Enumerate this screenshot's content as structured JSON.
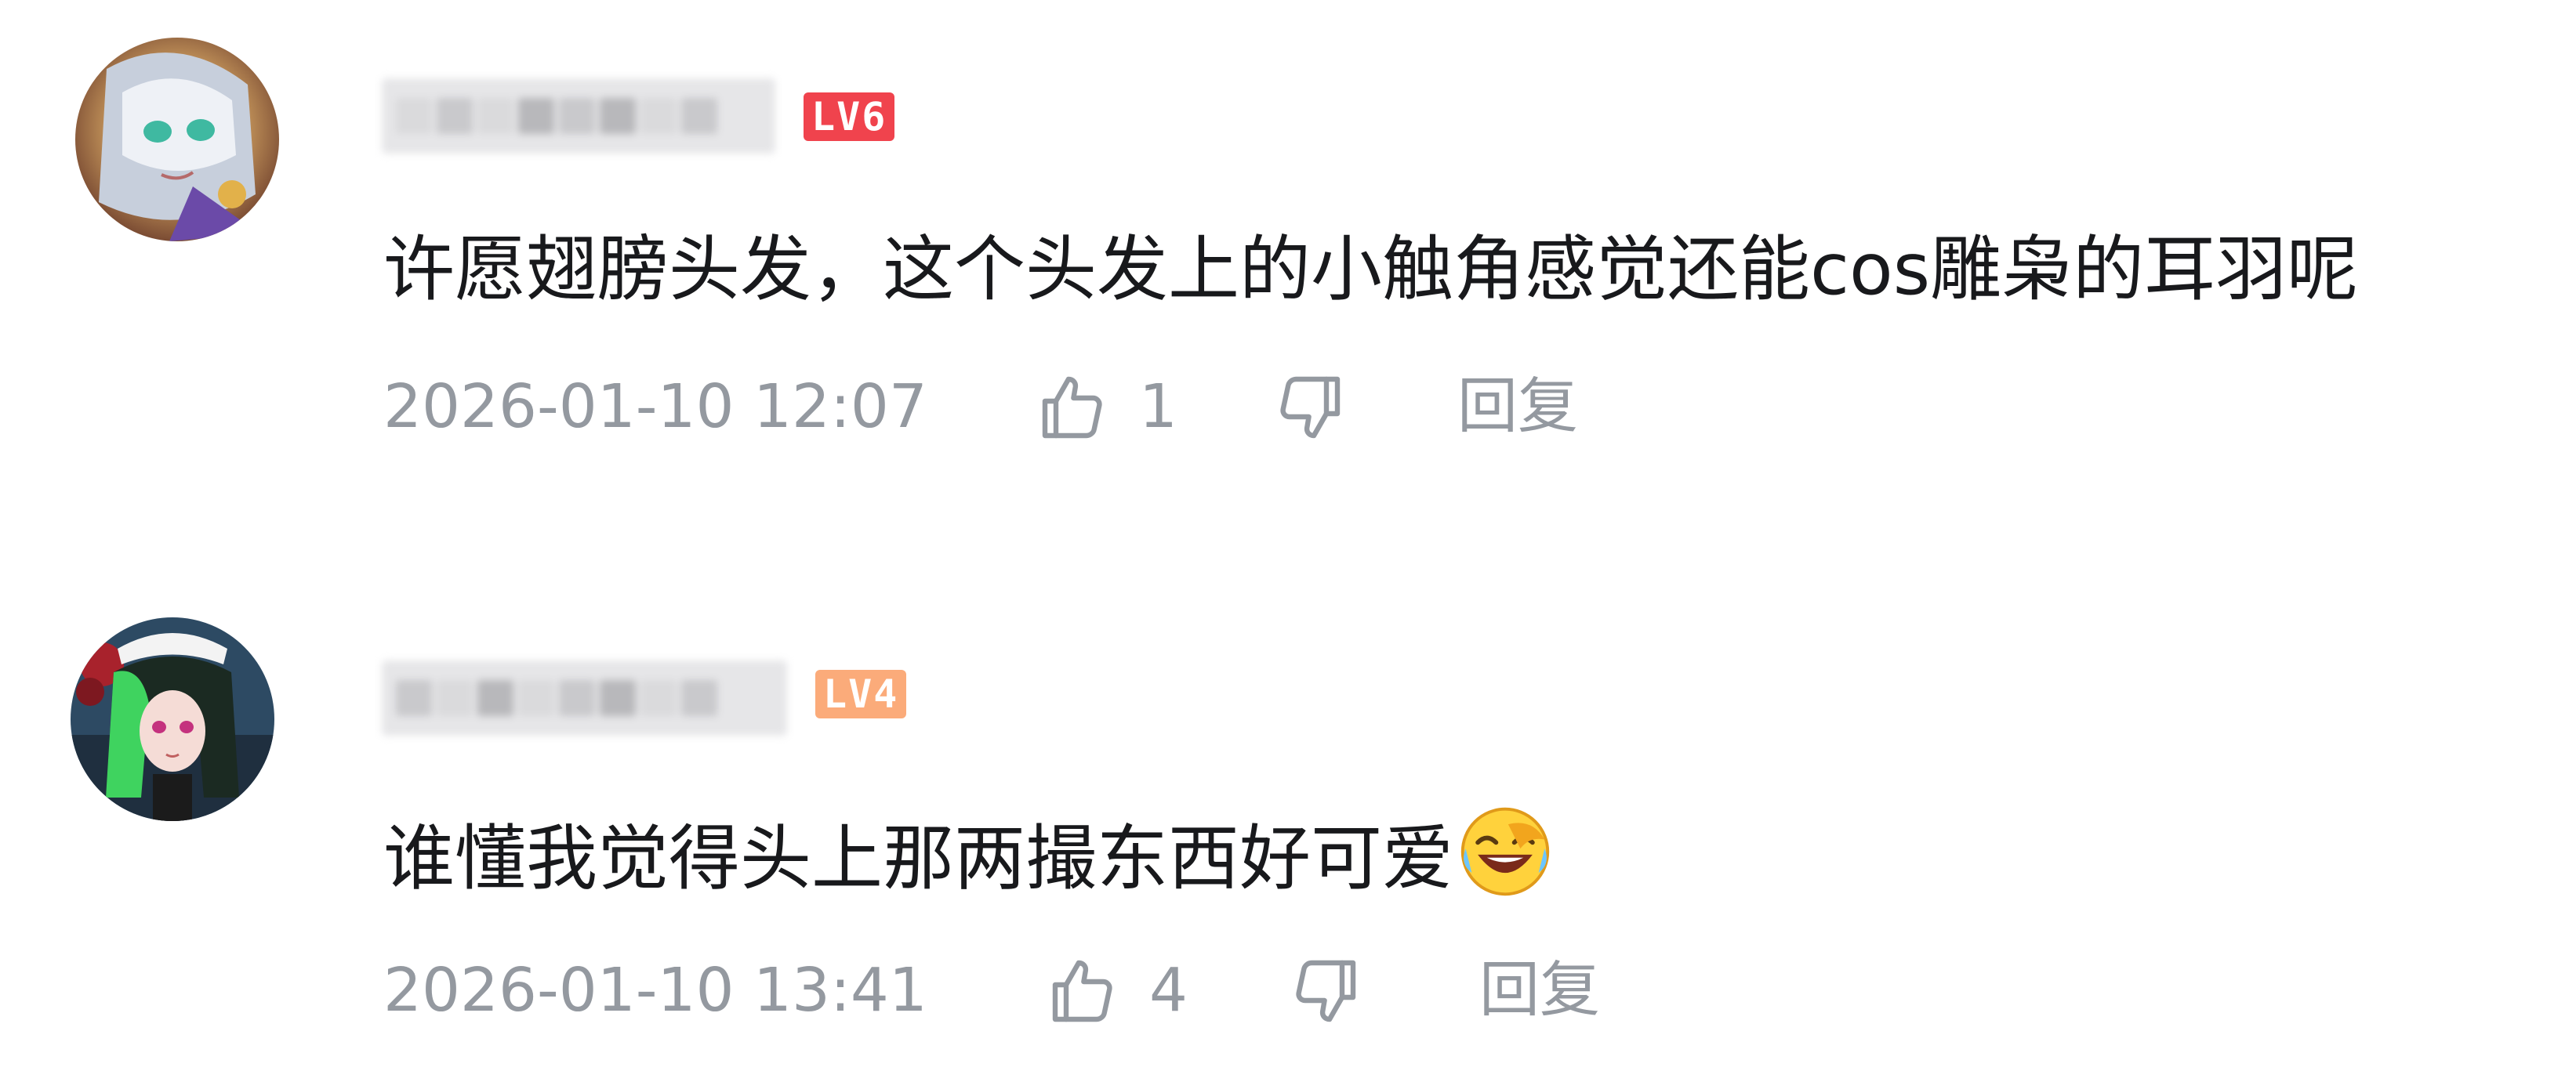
{
  "comments": [
    {
      "username": "",
      "level": "LV6",
      "level_color": "#f0434d",
      "text": "许愿翅膀头发，这个头发上的小触角感觉还能cos雕枭的耳羽呢",
      "date": "2026-01-10 12:07",
      "likes": "1",
      "reply_label": "回复"
    },
    {
      "username": "",
      "level": "LV4",
      "level_color": "#fbab7a",
      "text": "谁懂我觉得头上那两撮东西好可爱",
      "date": "2026-01-10 13:41",
      "likes": "4",
      "reply_label": "回复",
      "emoji": "laugh-cry-emoji"
    }
  ],
  "icons": {
    "like": "thumbs-up-icon",
    "dislike": "thumbs-down-icon"
  },
  "colors": {
    "meta_text": "#9499a0",
    "body_text": "#18191c"
  }
}
